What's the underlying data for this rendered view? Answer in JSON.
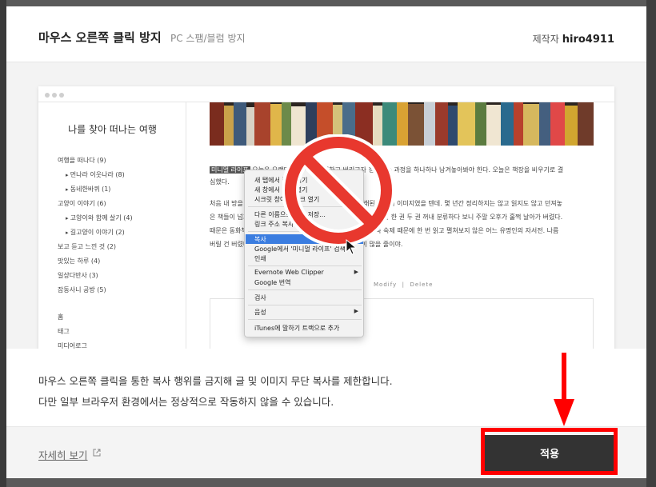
{
  "modal": {
    "title": "마우스 오른쪽 클릭 방지",
    "subtitle": "PC 스팸/블럼 방지",
    "author_label": "제작자",
    "author_name": "hiro4911"
  },
  "preview": {
    "blog_title": "나를 찾아 떠나는 여행",
    "categories": [
      {
        "label": "여행을 떠나다 (9)",
        "sub": false
      },
      {
        "label": "먼나라 이웃나라 (8)",
        "sub": true
      },
      {
        "label": "동네한바퀴 (1)",
        "sub": true
      },
      {
        "label": "고양이 이야기 (6)",
        "sub": false
      },
      {
        "label": "고양이와 함께 살기 (4)",
        "sub": true
      },
      {
        "label": "길고양이 이야기 (2)",
        "sub": true
      },
      {
        "label": "보고 듣고 느낀 것 (2)",
        "sub": false
      },
      {
        "label": "맛있는 하루 (4)",
        "sub": false
      },
      {
        "label": "일상다반사 (3)",
        "sub": false
      },
      {
        "label": "잡동사니 공방 (5)",
        "sub": false
      }
    ],
    "nav": [
      "홈",
      "태그",
      "미디어로그"
    ],
    "highlight": "미니멀 라이프",
    "para1_a": "오늘은 오랜만에 책장을 정리하고 버리고자 청소하는 과정을 하나하나 남겨놓아봐야 한다. 오늘은 책장을 비우기로 결",
    "para1_b": "심했다.",
    "para2": [
      "처음 내 방을 정리하고자 결심했을 때 떠오른 것은 일본 오래된 서재의 이미지였을 텐데. 몇 년간 정리하지는 않고 읽지도 않고 던져놓",
      "은 책들이 넘쳐나 있었다. 원래는 책을 좋아하는 것도 있었지만 책을 한 권 두 권 꺼내 분류하다 보니 주말 오후가 훌쩍 날아가 버렸다.",
      "때문은 동화책, 고전소설, 학창시절 교과서, 잡지 몇 권, 뒤죽박죽 숙제 때문에 한 번 읽고 펼쳐보지 않은 어느 유명인의 자서전. 나름",
      "버릴 건 버렸다고 생각했지만 막상 정리해 보니 여전히 책이 많을 줄이야."
    ],
    "modify_label": "Modify",
    "delete_label": "Delete",
    "context_menu": [
      "새 탭에서 링크 열기",
      "새 창에서 링크 열기",
      "시크릿 창에서 링크 열기",
      "다른 이름으로 링크 저장...",
      "링크 주소 복사",
      "복사",
      "Google에서 '미니멀 라이프' 검색",
      "인쇄",
      "Evernote Web Clipper",
      "Google 번역",
      "검사",
      "음성",
      "iTunes에 말하기 트랙으로 추가"
    ]
  },
  "description": {
    "line1": "마우스 오른쪽 클릭을 통한 복사 행위를 금지해 글 및 이미지 무단 복사를 제한합니다.",
    "line2": "다만 일부 브라우저 환경에서는 정상적으로 작동하지 않을 수 있습니다."
  },
  "footer": {
    "more_link": "자세히 보기",
    "apply_button": "적용"
  },
  "colors": {
    "apply_bg": "#333333",
    "annotation_red": "#ff0000",
    "prohibition_red": "#e8382e",
    "menu_highlight": "#3b7de0"
  },
  "icons": {
    "external_link": "external-link-icon",
    "no_sign": "prohibition-icon",
    "cursor": "mouse-cursor-icon"
  }
}
